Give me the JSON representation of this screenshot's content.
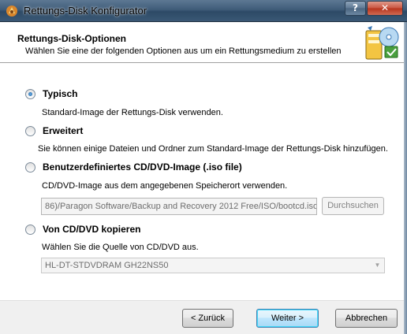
{
  "window": {
    "title": "Rettungs-Disk Konfigurator",
    "help_label": "?",
    "close_label": "✕"
  },
  "header": {
    "title": "Rettungs-Disk-Optionen",
    "subtitle": "Wählen Sie eine der folgenden Optionen aus um ein Rettungsmedium zu erstellen"
  },
  "options": [
    {
      "label": "Typisch",
      "description": "Standard-Image der Rettungs-Disk verwenden.",
      "selected": true
    },
    {
      "label": "Erweitert",
      "description": "Sie können einige Dateien und Ordner zum Standard-Image der Rettungs-Disk hinzufügen.",
      "selected": false
    },
    {
      "label": "Benutzerdefiniertes CD/DVD-Image (.iso file)",
      "description": "CD/DVD-Image aus dem angegebenen Speicherort verwenden.",
      "selected": false
    },
    {
      "label": "Von CD/DVD kopieren",
      "description": "Wählen Sie die Quelle von CD/DVD aus.",
      "selected": false
    }
  ],
  "iso_path": {
    "value": "86)/Paragon Software/Backup and Recovery 2012 Free/ISO/bootcd.iso",
    "browse_label": "Durchsuchen",
    "enabled": false
  },
  "drive_select": {
    "value": "HL-DT-STDVDRAM GH22NS50",
    "enabled": false
  },
  "footer": {
    "back_label": "< Zurück",
    "next_label": "Weiter >",
    "cancel_label": "Abbrechen"
  }
}
